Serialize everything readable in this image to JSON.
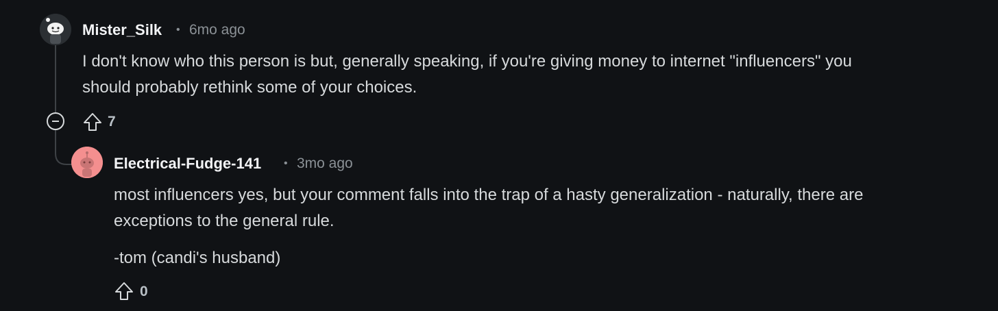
{
  "comments": [
    {
      "username": "Mister_Silk",
      "separator": "•",
      "time": "6mo ago",
      "avatar_icon": "snoo-avatar-icon",
      "body": [
        "I don't know who this person is but, generally speaking, if you're giving money to internet \"influencers\" you",
        "should probably rethink some of your choices."
      ],
      "upvote_icon": "upvote-arrow-icon",
      "score": "7",
      "collapse_icon": "collapse-minus-icon"
    },
    {
      "username": "Electrical-Fudge-141",
      "separator": "•",
      "time": "3mo ago",
      "avatar_icon": "snoo-avatar-icon",
      "avatar_color": "#f48f8f",
      "body": [
        "most influencers yes, but your comment falls into the trap of a hasty generalization - naturally, there are",
        "exceptions to the general rule."
      ],
      "body2": "-tom (candi's husband)",
      "upvote_icon": "upvote-arrow-icon",
      "score": "0"
    }
  ]
}
